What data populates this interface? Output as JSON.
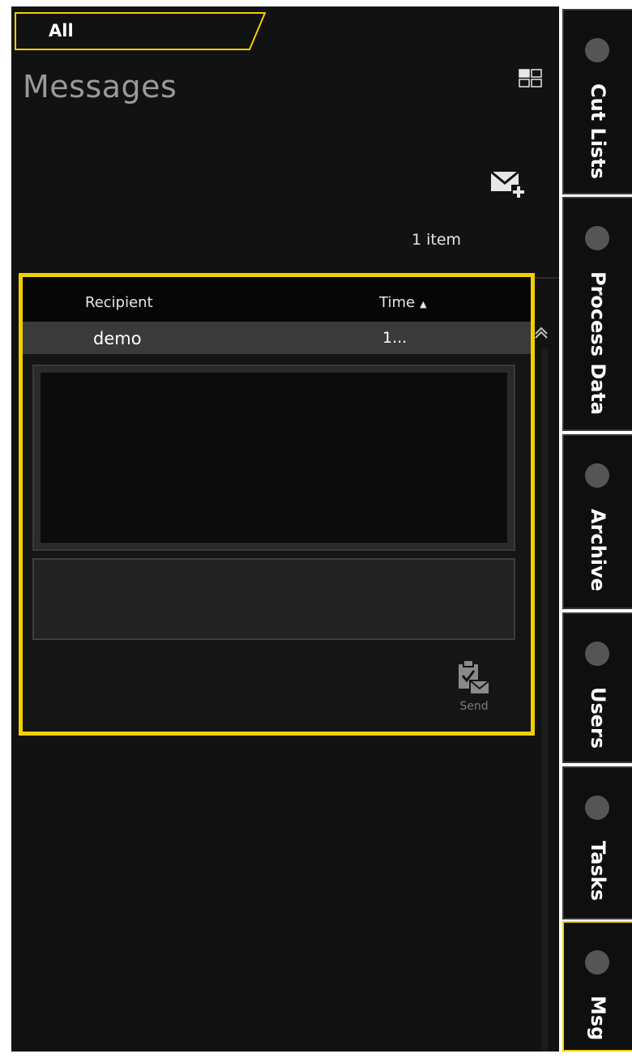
{
  "filter": {
    "label": "All"
  },
  "page": {
    "title": "Messages"
  },
  "toolbar": {
    "grid_icon": "grid-view-icon",
    "new_message_icon": "new-message-icon"
  },
  "list": {
    "count_label": "1 item",
    "columns": {
      "recipient": "Recipient",
      "time": "Time"
    },
    "sort_indicator": "▲",
    "rows": [
      {
        "recipient": "demo",
        "time": "1..."
      }
    ]
  },
  "compose": {
    "send_label": "Send"
  },
  "side_tabs": [
    {
      "label": "Cut Lists",
      "active": false
    },
    {
      "label": "Process Data",
      "active": false
    },
    {
      "label": "Archive",
      "active": false
    },
    {
      "label": "Users",
      "active": false
    },
    {
      "label": "Tasks",
      "active": false
    },
    {
      "label": "Msg",
      "active": true
    }
  ],
  "colors": {
    "accent": "#f2cf00",
    "background": "#121212",
    "selected_row": "#3a3a3a"
  }
}
